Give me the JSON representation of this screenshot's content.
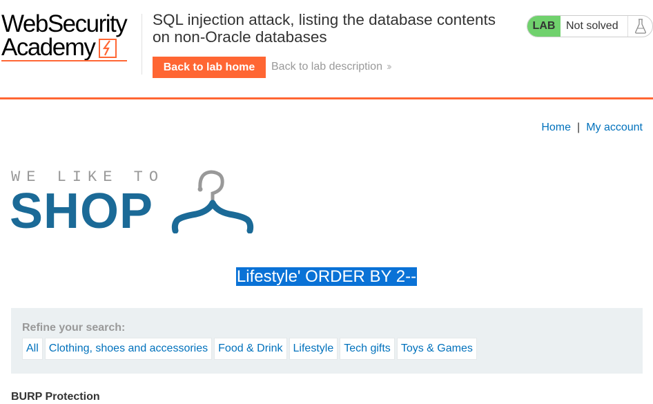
{
  "header": {
    "logo_line1": "WebSecurity",
    "logo_line2": "Academy",
    "lab_title": "SQL injection attack, listing the database contents on non-Oracle databases",
    "back_button": "Back to lab home",
    "description_link": "Back to lab description",
    "status": {
      "badge": "LAB",
      "text": "Not solved",
      "badge_color": "#70d16d",
      "icon": "flask-icon"
    },
    "accent_color": "#ff6633"
  },
  "nav": {
    "home": "Home",
    "separator": "|",
    "account": "My account",
    "link_color": "#0071bc"
  },
  "shop_logo": {
    "subtitle": "WE LIKE TO",
    "title": "SHOP",
    "color": "#1b6a97",
    "icon": "hanger-icon"
  },
  "search": {
    "heading": "Lifestyle' ORDER BY 2--",
    "highlight_color": "#0a72d6"
  },
  "filters": {
    "label": "Refine your search:",
    "items": [
      "All",
      "Clothing, shoes and accessories",
      "Food & Drink",
      "Lifestyle",
      "Tech gifts",
      "Toys & Games"
    ]
  },
  "products": {
    "first_title": "BURP Protection"
  }
}
